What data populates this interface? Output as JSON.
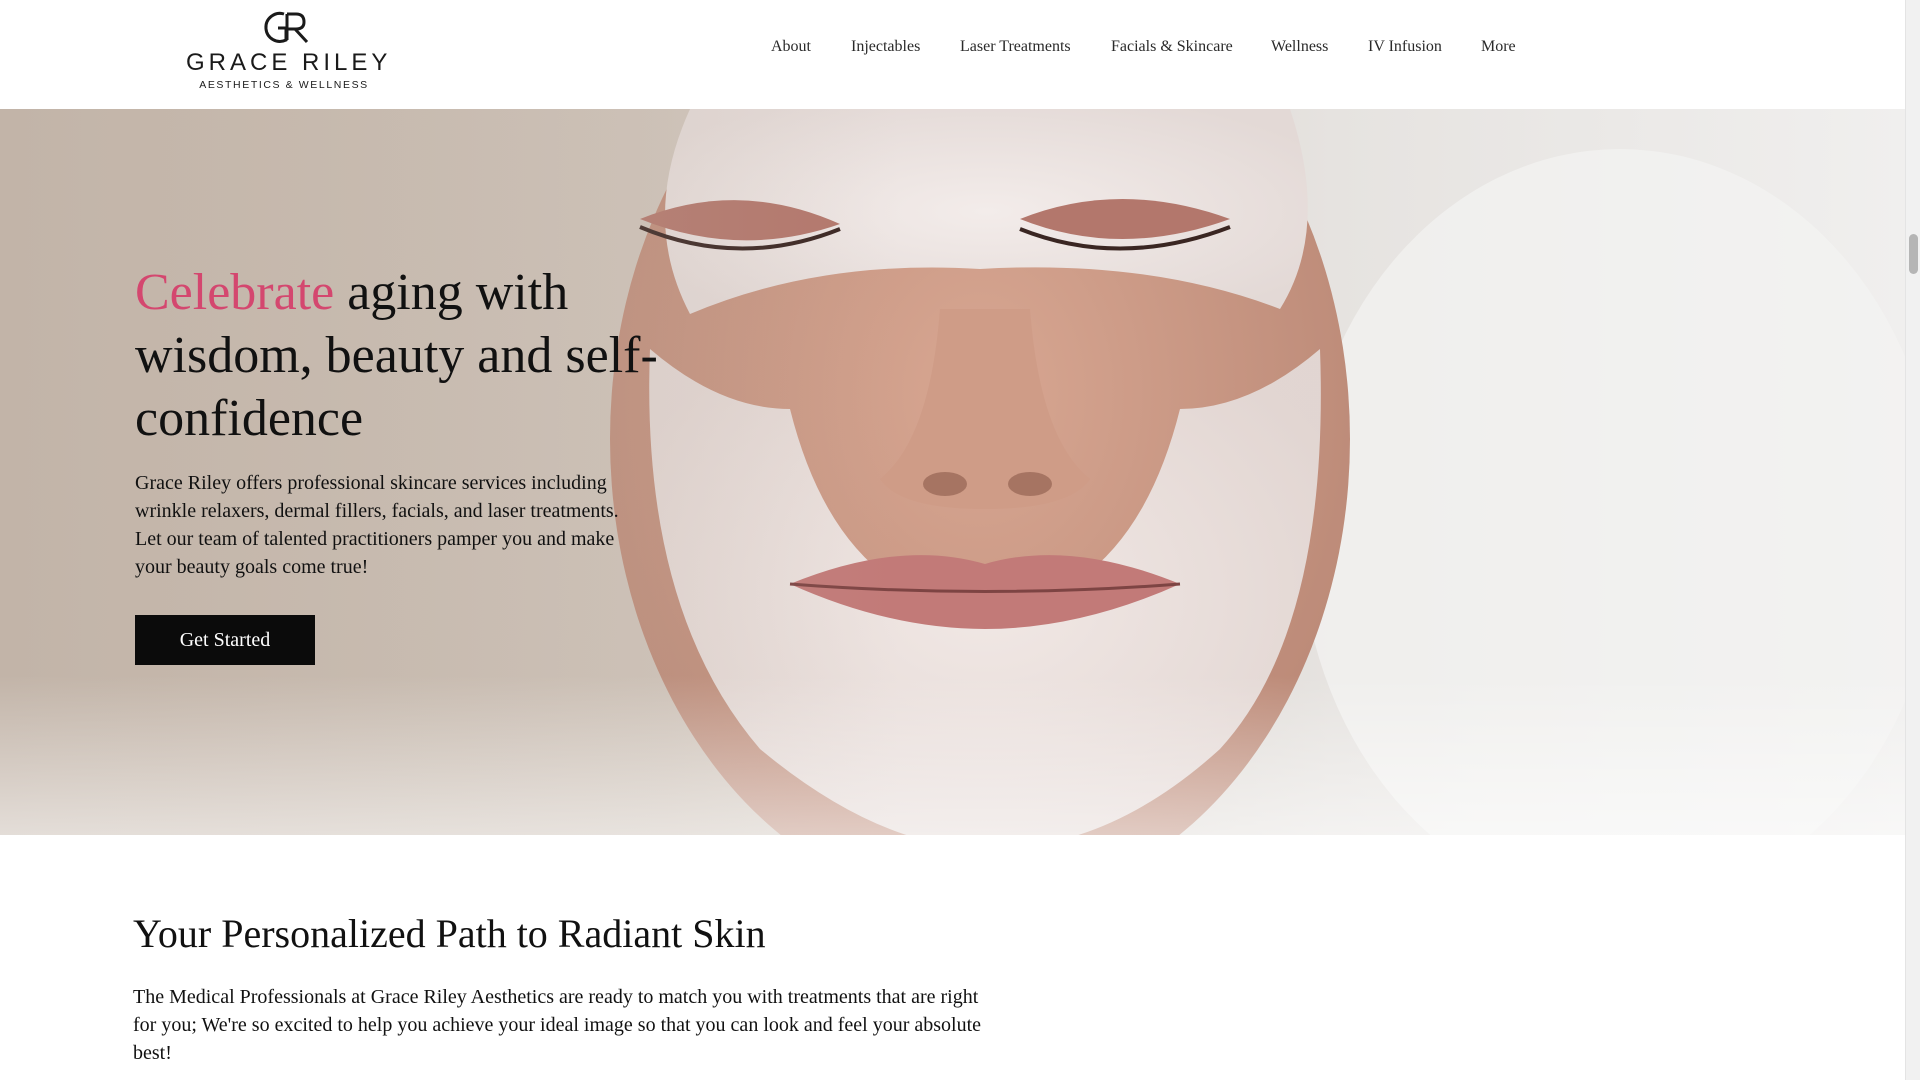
{
  "brand": {
    "monogram": "GR",
    "name": "GRACE RILEY",
    "tagline": "AESTHETICS & WELLNESS"
  },
  "nav": {
    "items": [
      {
        "label": "About"
      },
      {
        "label": "Injectables"
      },
      {
        "label": "Laser Treatments"
      },
      {
        "label": "Facials & Skincare"
      },
      {
        "label": "Wellness"
      },
      {
        "label": "IV Infusion"
      },
      {
        "label": "More"
      }
    ]
  },
  "hero": {
    "title_accent": "Celebrate",
    "title_rest": " aging with wisdom, beauty and self-confidence",
    "description": "Grace Riley offers professional skincare services including wrinkle relaxers, dermal fillers, facials, and laser treatments. Let our team of talented practitioners pamper you and make your beauty goals come true!",
    "cta_label": "Get Started",
    "accent_color": "#d4476f"
  },
  "section": {
    "title": "Your Personalized Path to Radiant Skin",
    "text": "The Medical Professionals at Grace Riley Aesthetics are ready to match you with treatments that are right for you; We're so excited to help you achieve your ideal image so that you can look and feel your absolute best!"
  }
}
